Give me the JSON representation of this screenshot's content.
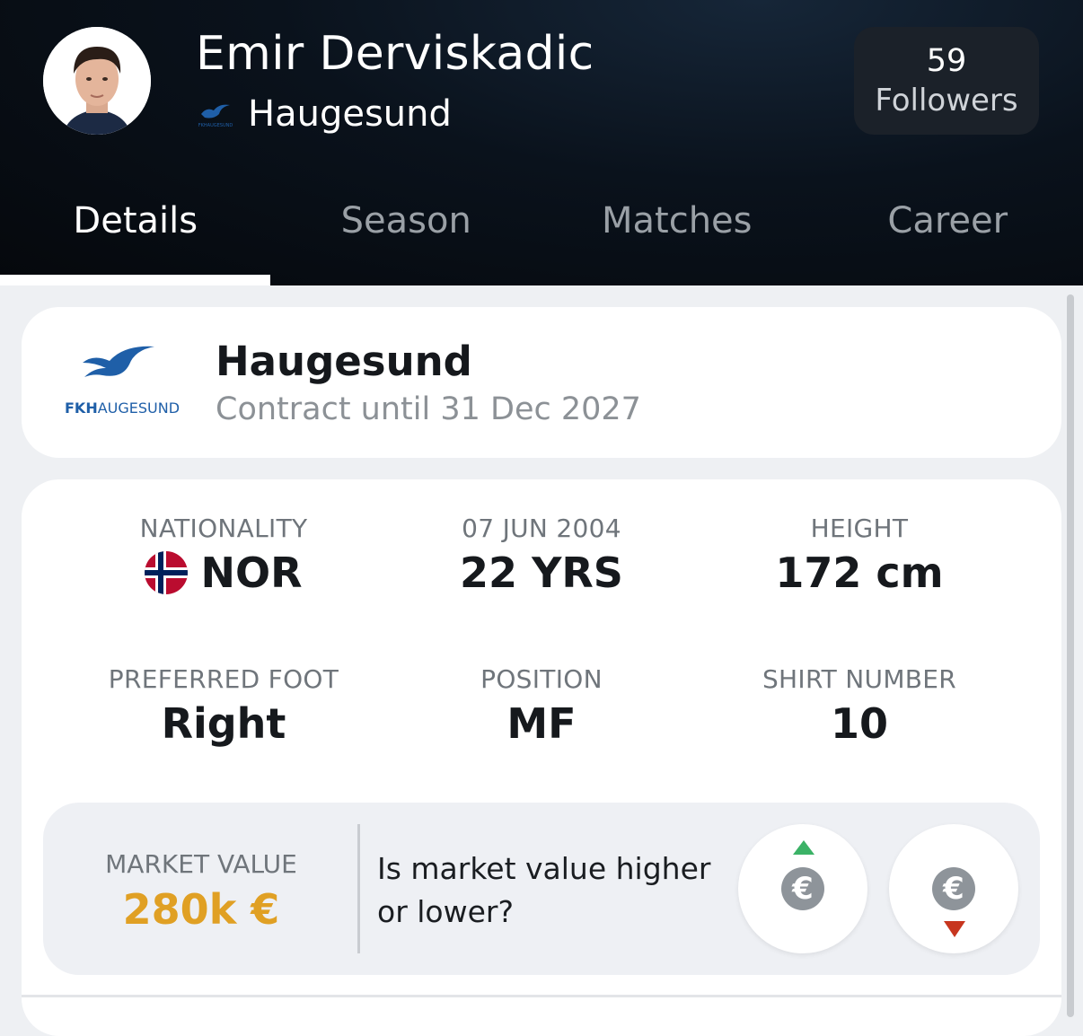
{
  "header": {
    "player_name": "Emir Derviskadic",
    "team": "Haugesund",
    "team_logo_text": "FKHAUGESUND",
    "followers_count": "59",
    "followers_label": "Followers"
  },
  "tabs": [
    {
      "label": "Details",
      "active": true
    },
    {
      "label": "Season"
    },
    {
      "label": "Matches"
    },
    {
      "label": "Career"
    }
  ],
  "club": {
    "name": "Haugesund",
    "logo_text_bold": "FKH",
    "logo_text": "AUGESUND",
    "contract": "Contract until 31 Dec 2027"
  },
  "details": {
    "nationality_label": "NATIONALITY",
    "nationality": "NOR",
    "dob_label": "07 JUN 2004",
    "age": "22 YRS",
    "height_label": "HEIGHT",
    "height": "172 cm",
    "foot_label": "PREFERRED FOOT",
    "foot": "Right",
    "position_label": "POSITION",
    "position": "MF",
    "shirt_label": "SHIRT NUMBER",
    "shirt": "10"
  },
  "market": {
    "label": "MARKET VALUE",
    "value": "280k €",
    "question": "Is market value higher or lower?",
    "currency_symbol": "€"
  },
  "colors": {
    "market_value": "#e0a024",
    "up_arrow": "#3bb266",
    "down_arrow": "#c7361f",
    "club_blue": "#1f5fa8"
  }
}
